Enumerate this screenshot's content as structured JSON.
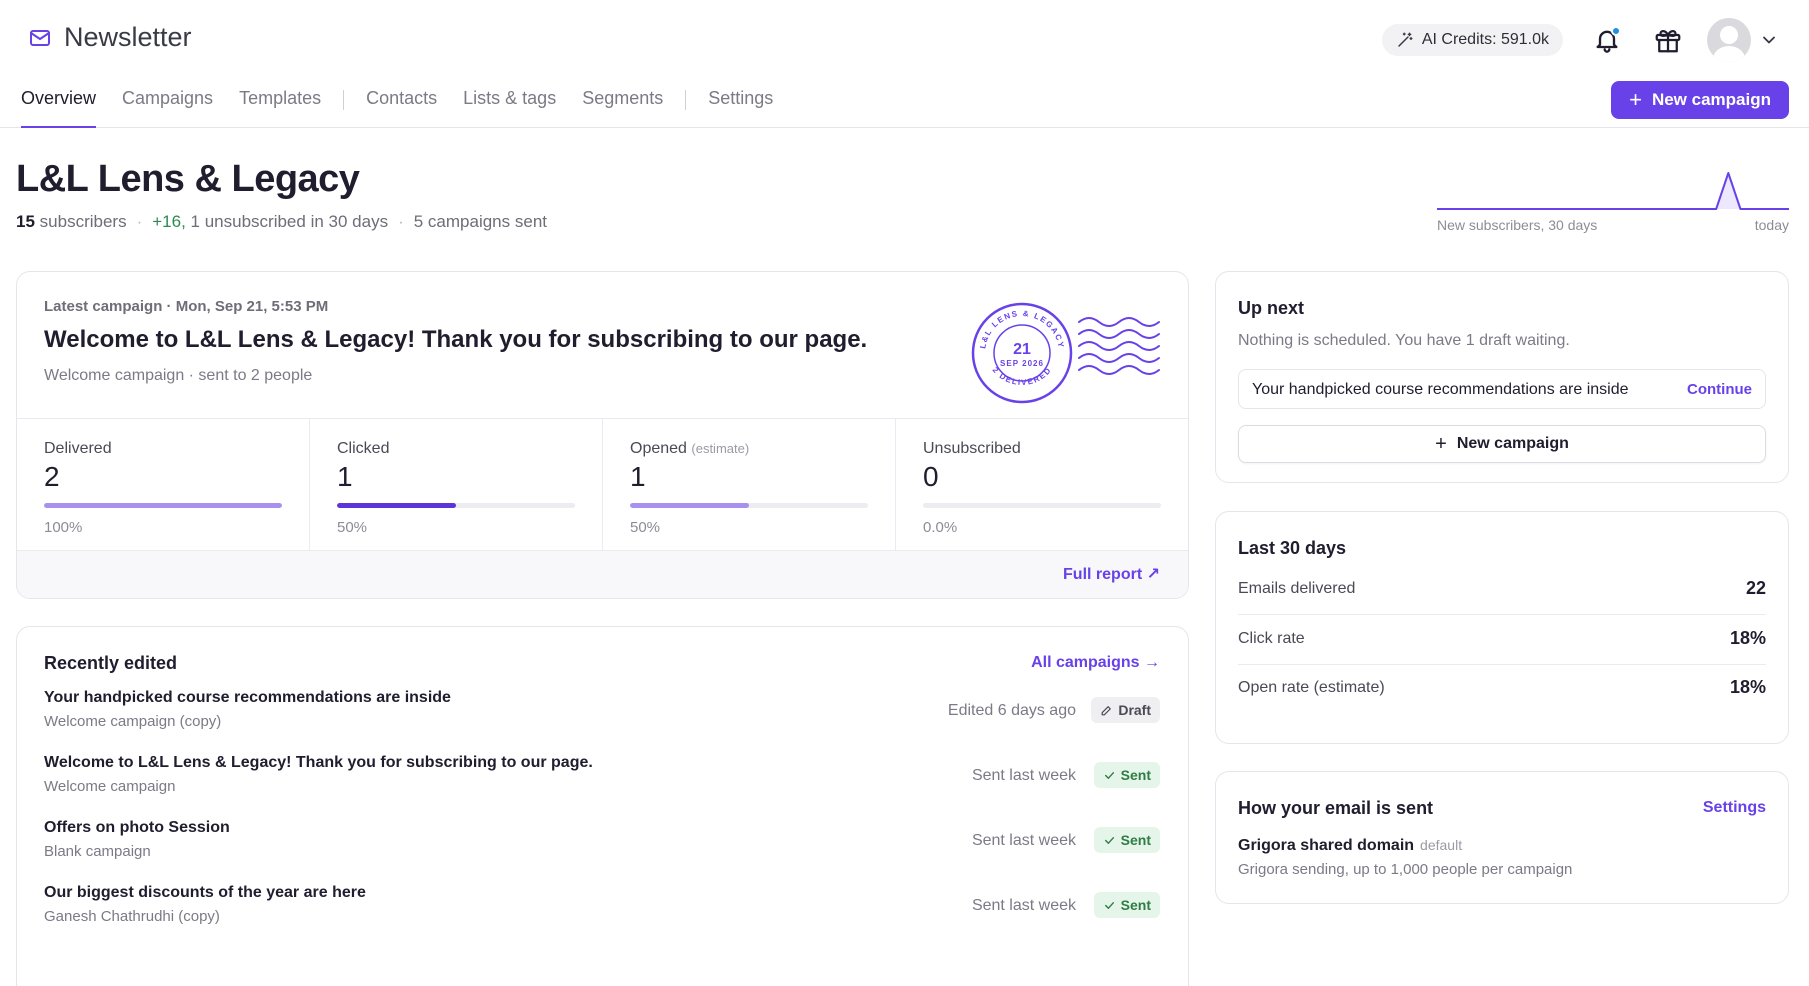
{
  "app": {
    "title": "Newsletter",
    "brand_color": "#6842e8"
  },
  "header": {
    "credits_label": "AI Credits: 591.0k",
    "new_campaign_label": "New campaign",
    "notification_dot_color": "#1f8fe0"
  },
  "tabs": [
    {
      "label": "Overview",
      "active": true
    },
    {
      "label": "Campaigns"
    },
    {
      "label": "Templates"
    },
    {
      "label": "Contacts"
    },
    {
      "label": "Lists & tags"
    },
    {
      "label": "Segments"
    },
    {
      "label": "Settings"
    }
  ],
  "org": {
    "name": "L&L Lens & Legacy",
    "subscribers_count": "15",
    "subscribers_label": "subscribers",
    "growth": "+16,",
    "unsubscribed_text": "1 unsubscribed in 30 days",
    "campaigns_sent": "5 campaigns sent"
  },
  "sparkline": {
    "left_label": "New subscribers, 30 days",
    "right_label": "today",
    "values": [
      0,
      0,
      0,
      0,
      0,
      0,
      0,
      0,
      0,
      0,
      0,
      0,
      0,
      0,
      0,
      0,
      0,
      0,
      0,
      0,
      0,
      0,
      0,
      0,
      16,
      0,
      0,
      0,
      0,
      0
    ]
  },
  "latest": {
    "meta": "Latest campaign · Mon, Sep 21, 5:53 PM",
    "title": "Welcome to L&L Lens & Legacy! Thank you for subscribing to our page.",
    "sub": "Welcome campaign · sent to 2 people",
    "stamp": {
      "ring_text": "L&L LENS & LEGACY",
      "day": "21",
      "month_year": "SEP 2026",
      "bottom_text": "2 DELIVERED"
    },
    "stats": [
      {
        "label": "Delivered",
        "estimate": "",
        "value": "2",
        "pct": "100%",
        "fraction": 1.0,
        "color": "#a891ee"
      },
      {
        "label": "Clicked",
        "estimate": "",
        "value": "1",
        "pct": "50%",
        "fraction": 0.5,
        "color": "#5b35d9"
      },
      {
        "label": "Opened",
        "estimate": "(estimate)",
        "value": "1",
        "pct": "50%",
        "fraction": 0.5,
        "color": "#a891ee"
      },
      {
        "label": "Unsubscribed",
        "estimate": "",
        "value": "0",
        "pct": "0.0%",
        "fraction": 0.0,
        "color": "#a891ee"
      }
    ],
    "full_report": "Full report ↗"
  },
  "recent": {
    "title": "Recently edited",
    "all_link": "All campaigns →",
    "items": [
      {
        "title": "Your handpicked course recommendations are inside",
        "sub": "Welcome campaign (copy)",
        "when": "Edited 6 days ago",
        "status": "Draft"
      },
      {
        "title": "Welcome to L&L Lens & Legacy! Thank you for subscribing to our page.",
        "sub": "Welcome campaign",
        "when": "Sent last week",
        "status": "Sent"
      },
      {
        "title": "Offers on photo Session",
        "sub": "Blank campaign",
        "when": "Sent last week",
        "status": "Sent"
      },
      {
        "title": "Our biggest discounts of the year are here",
        "sub": "Ganesh Chathrudhi (copy)",
        "when": "Sent last week",
        "status": "Sent"
      }
    ]
  },
  "upnext": {
    "title": "Up next",
    "note": "Nothing is scheduled. You have 1 draft waiting.",
    "draft_title": "Your handpicked course recommendations are inside",
    "continue": "Continue",
    "new_campaign": "New campaign"
  },
  "last30": {
    "title": "Last 30 days",
    "rows": [
      {
        "k": "Emails delivered",
        "v": "22"
      },
      {
        "k": "Click rate",
        "v": "18%"
      },
      {
        "k": "Open rate (estimate)",
        "v": "18%"
      }
    ]
  },
  "how": {
    "title": "How your email is sent",
    "settings": "Settings",
    "domain": "Grigora shared domain",
    "default_tag": "default",
    "desc": "Grigora sending, up to 1,000 people per campaign"
  }
}
